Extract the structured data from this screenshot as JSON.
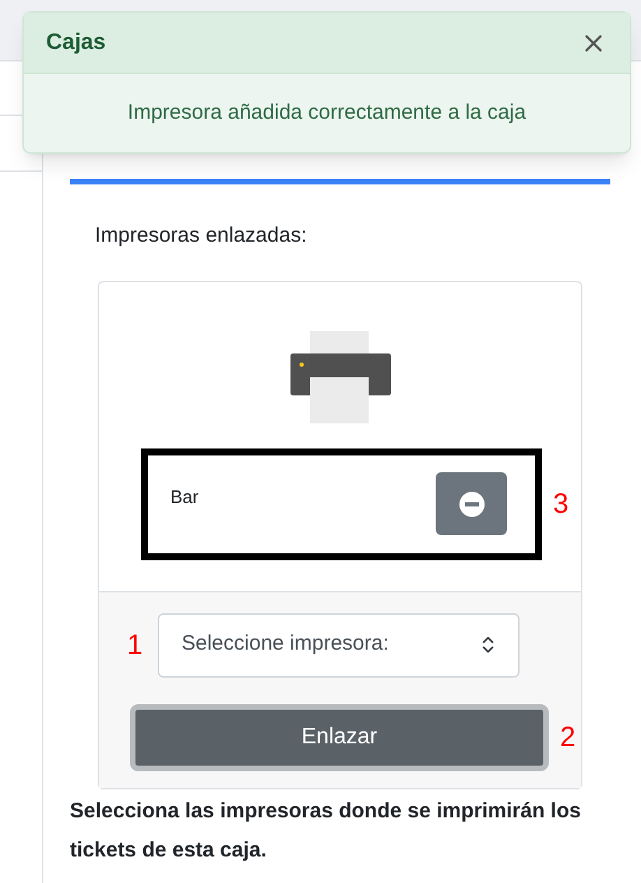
{
  "toast": {
    "title": "Cajas",
    "message": "Impresora añadida correctamente a la caja"
  },
  "linked_printers": {
    "heading": "Impresoras enlazadas:",
    "printers": [
      {
        "name": "Bar",
        "highlighted": true,
        "annotation": "3"
      }
    ],
    "select": {
      "value": "Seleccione impresora:",
      "annotation": "1"
    },
    "button": {
      "label": "Enlazar",
      "focused": true,
      "annotation": "2"
    }
  },
  "help_text": "Selecciona las impresoras donde se imprimirán los tickets de esta caja."
}
